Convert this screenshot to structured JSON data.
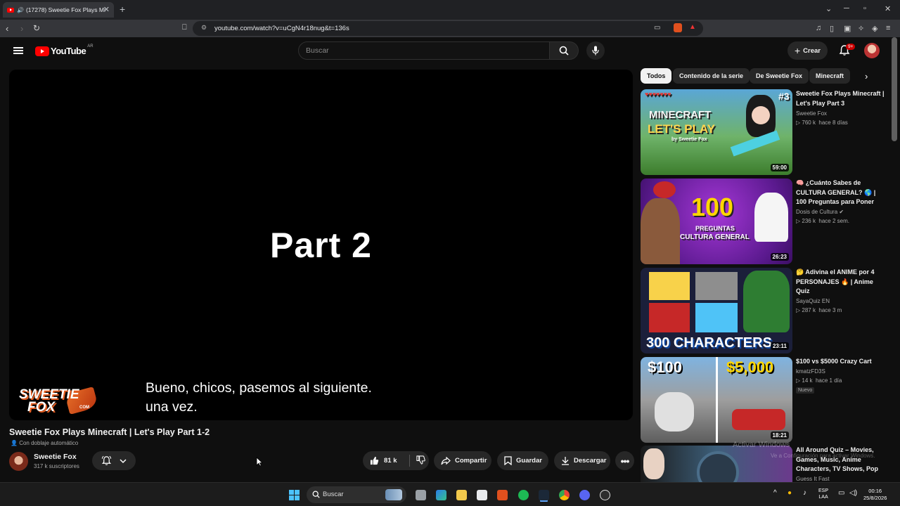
{
  "browser": {
    "tab_title": "(17278) Sweetie Fox Plays Mi",
    "url": "youtube.com/watch?v=uCgN4r18nug&t=136s"
  },
  "header": {
    "logo_text": "YouTube",
    "country_code": "AR",
    "search_placeholder": "Buscar",
    "create_label": "Crear",
    "notifications_badge": "9+"
  },
  "player": {
    "overlay_text": "Part 2",
    "subtitle_line1": "Bueno, chicos, pasemos al siguiente.",
    "subtitle_line2": "una vez.",
    "watermark_line1": "SWEETIE",
    "watermark_line2": "FOX",
    "watermark_suffix": "COM"
  },
  "video": {
    "title": "Sweetie Fox Plays Minecraft | Let's Play Part 1-2",
    "dub_label": "Con doblaje automático",
    "channel_name": "Sweetie Fox",
    "subscribers": "317 k suscriptores",
    "likes": "81 k",
    "share_label": "Compartir",
    "save_label": "Guardar",
    "download_label": "Descargar"
  },
  "sidebar": {
    "chips": [
      "Todos",
      "Contenido de la serie",
      "De Sweetie Fox",
      "Minecraft"
    ],
    "videos": [
      {
        "title": "Sweetie Fox Plays Minecraft | Let's Play Part 3",
        "channel": "Sweetie Fox",
        "views": "760 k",
        "age": "hace 8 días",
        "duration": "59:00",
        "thumb_text1": "MINECRAFT",
        "thumb_text2": "LET'S PLAY",
        "thumb_badge": "#3",
        "thumb_by": "by Sweetie Fox"
      },
      {
        "title": "🧠 ¿Cuánto Sabes de CULTURA GENERAL? 🌎 | 100 Preguntas para Poner a...",
        "channel": "Dosis de Cultura",
        "views": "236 k",
        "age": "hace 2 sem.",
        "duration": "26:23",
        "thumb_text1": "100",
        "thumb_text2": "PREGUNTAS",
        "thumb_text3": "CULTURA GENERAL"
      },
      {
        "title": "🤔 Adivina el ANIME por 4 PERSONAJES 🔥 | Anime Quiz",
        "channel": "SayaQuiz EN",
        "views": "287 k",
        "age": "hace 3 m",
        "duration": "23:11",
        "thumb_text1": "300 CHARACTERS"
      },
      {
        "title": "$100 vs $5000 Crazy Cart",
        "channel": "kmatzFD3S",
        "views": "14 k",
        "age": "hace 1 día",
        "duration": "18:21",
        "badge": "Nuevo",
        "thumb_text1": "$100",
        "thumb_text2": "$5,000"
      },
      {
        "title": "All Around Quiz – Movies, Games, Music, Anime Characters, TV Shows, Pop ...",
        "channel": "Guess It Fast"
      }
    ]
  },
  "windows_watermark": {
    "line1": "Activar Windows",
    "line2": "Ve a Configuración para activar Windows."
  },
  "taskbar": {
    "search_label": "Buscar",
    "lang_line1": "ESP",
    "lang_line2": "LAA",
    "time": "00:16",
    "date": "25/8/2026"
  }
}
